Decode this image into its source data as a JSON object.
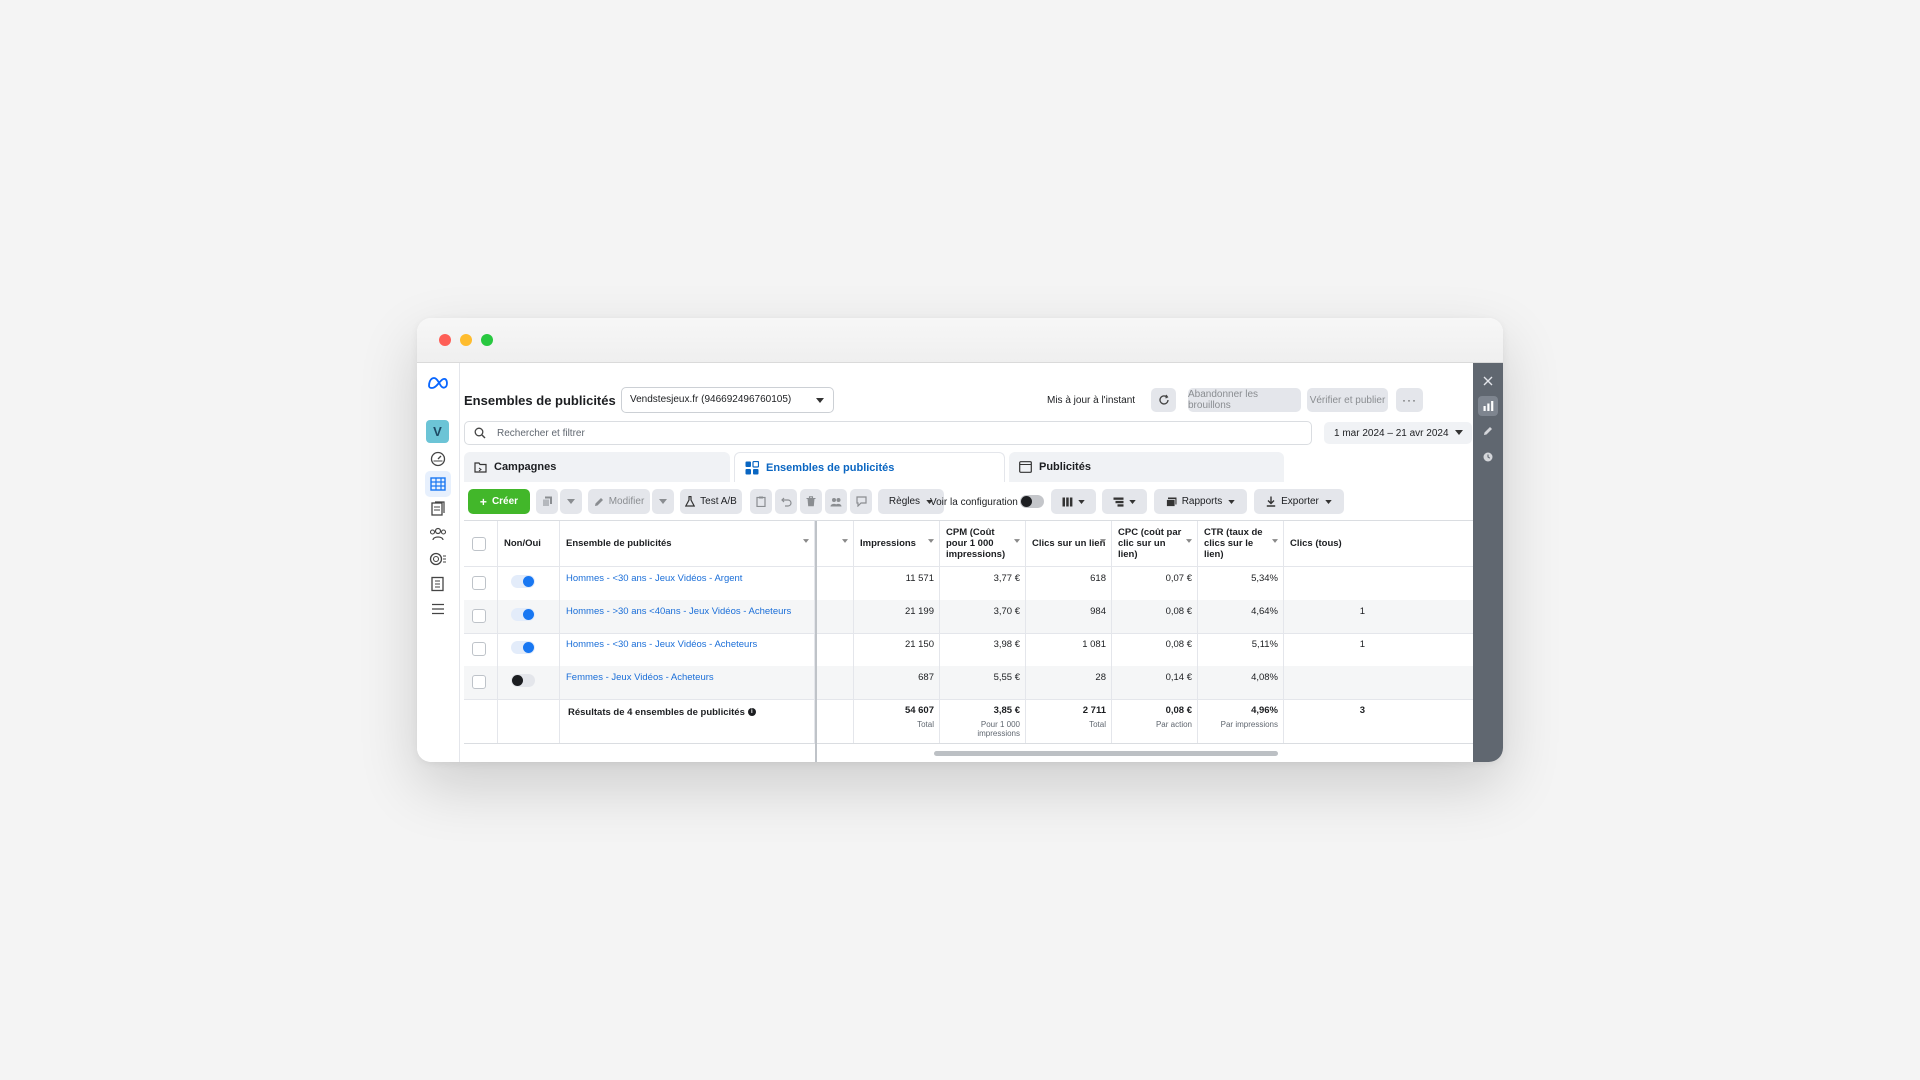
{
  "window": {
    "controls": [
      "close",
      "minimize",
      "zoom"
    ]
  },
  "nav": {
    "avatar_letter": "V",
    "items": [
      "meta-logo-icon",
      "dashboard-icon",
      "table-icon",
      "pages-icon",
      "audience-icon",
      "ad-targeting-icon",
      "billing-icon",
      "menu-icon"
    ]
  },
  "header": {
    "title": "Ensembles de publicités",
    "account": "Vendstesjeux.fr (946692496760105)",
    "updated": "Mis à jour à l'instant",
    "discard_label": "Abandonner les brouillons",
    "publish_label": "Vérifier et publier",
    "more_label": "···"
  },
  "search": {
    "placeholder": "Rechercher et filtrer"
  },
  "date_range": "1 mar 2024 – 21 avr 2024",
  "tabs": [
    {
      "label": "Campagnes",
      "active": false
    },
    {
      "label": "Ensembles de publicités",
      "active": true
    },
    {
      "label": "Publicités",
      "active": false
    }
  ],
  "toolbar": {
    "create": "Créer",
    "edit": "Modifier",
    "ab_test": "Test A/B",
    "rules": "Règles",
    "view_config": "Voir la configuration",
    "reports": "Rapports",
    "export": "Exporter"
  },
  "table": {
    "columns": {
      "toggle": "Non/Oui",
      "name": "Ensemble de publicités",
      "impressions": "Impressions",
      "cpm": "CPM (Coût pour 1 000 impressions)",
      "link_clicks": "Clics sur un lien",
      "cpc": "CPC (coût par clic sur un lien)",
      "ctr": "CTR (taux de clics sur le lien)",
      "clicks_all": "Clics (tous)"
    },
    "rows": [
      {
        "name": "Hommes - <30 ans - Jeux Vidéos - Argent",
        "on": true,
        "impressions": "11 571",
        "cpm": "3,77 €",
        "link_clicks": "618",
        "cpc": "0,07 €",
        "ctr": "5,34%",
        "clicks_all": ""
      },
      {
        "name": "Hommes - >30 ans <40ans - Jeux Vidéos - Acheteurs",
        "on": true,
        "impressions": "21 199",
        "cpm": "3,70 €",
        "link_clicks": "984",
        "cpc": "0,08 €",
        "ctr": "4,64%",
        "clicks_all": "1"
      },
      {
        "name": "Hommes - <30 ans - Jeux Vidéos - Acheteurs",
        "on": true,
        "impressions": "21 150",
        "cpm": "3,98 €",
        "link_clicks": "1 081",
        "cpc": "0,08 €",
        "ctr": "5,11%",
        "clicks_all": "1"
      },
      {
        "name": "Femmes - Jeux Vidéos - Acheteurs",
        "on": false,
        "impressions": "687",
        "cpm": "5,55 €",
        "link_clicks": "28",
        "cpc": "0,14 €",
        "ctr": "4,08%",
        "clicks_all": ""
      }
    ],
    "summary": {
      "label": "Résultats de 4 ensembles de publicités",
      "impressions": "54 607",
      "impressions_sub": "Total",
      "cpm": "3,85 €",
      "cpm_sub": "Pour 1 000 impressions",
      "link_clicks": "2 711",
      "link_clicks_sub": "Total",
      "cpc": "0,08 €",
      "cpc_sub": "Par action",
      "ctr": "4,96%",
      "ctr_sub": "Par impressions",
      "clicks_all": "3"
    }
  }
}
